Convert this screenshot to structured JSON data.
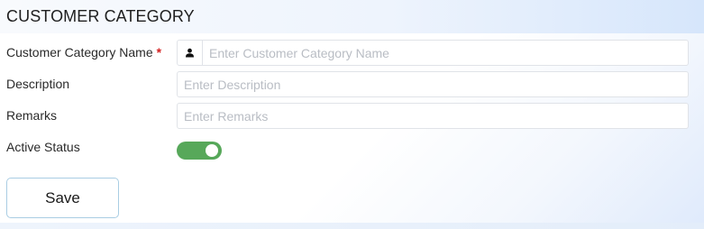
{
  "header": {
    "title": "CUSTOMER CATEGORY"
  },
  "form": {
    "category_name": {
      "label": "Customer Category Name",
      "required_mark": "*",
      "placeholder": "Enter Customer Category Name",
      "value": "",
      "icon": "user-icon"
    },
    "description": {
      "label": "Description",
      "placeholder": "Enter Description",
      "value": ""
    },
    "remarks": {
      "label": "Remarks",
      "placeholder": "Enter Remarks",
      "value": ""
    },
    "active_status": {
      "label": "Active Status",
      "enabled": true,
      "color": "#57a85a"
    }
  },
  "actions": {
    "save_label": "Save"
  }
}
